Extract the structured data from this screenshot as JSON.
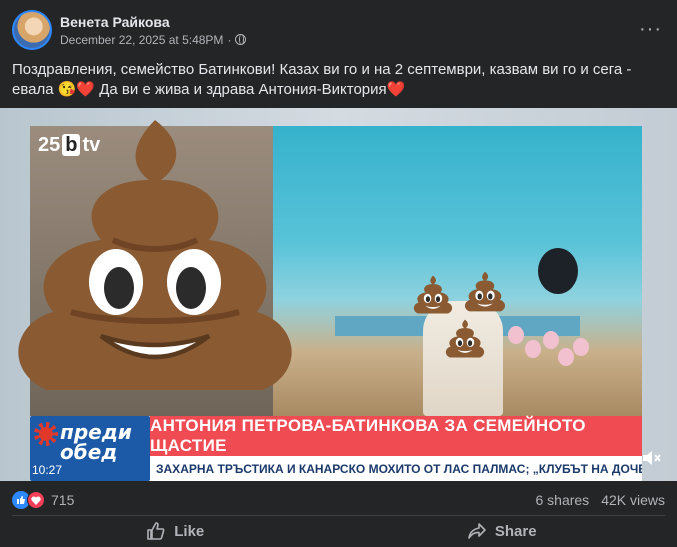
{
  "post": {
    "author": "Венета Райкова",
    "date": "December 22, 2025 at 5:48PM",
    "separator": "·",
    "more_label": "···",
    "text": "Поздравления, семейство Батинкови! Казах ви го и на 2 септември, казвам ви го и сега - евала 😘❤️ Да ви е жива и здрава Антония-Виктория❤️"
  },
  "media": {
    "tv_logo_number": "25",
    "tv_logo_mark": "b",
    "tv_logo_suffix": "tv",
    "show_name": "преди обед",
    "clock": "10:27",
    "headline": "АНТОНИЯ ПЕТРОВА-БАТИНКОВА ЗА СЕМЕЙНОТО ЩАСТИЕ",
    "ticker": "ЗАХАРНА ТРЪСТИКА И КАНАРСКО МОХИТО ОТ ЛАС ПАЛМАС; „КЛУБЪТ НА ДОЧЕВ\" - ОД",
    "overlay_emoji": "poop-emoji"
  },
  "stats": {
    "reactions_count": "715",
    "shares": "6 shares",
    "views": "42K views"
  },
  "actions": {
    "like_label": "Like",
    "share_label": "Share"
  },
  "colors": {
    "background": "#242526",
    "text": "#e4e6eb",
    "muted": "#b0b3b8",
    "like_blue": "#2d88ff",
    "love_red": "#f33e58",
    "headline_red": "#f04a53"
  }
}
